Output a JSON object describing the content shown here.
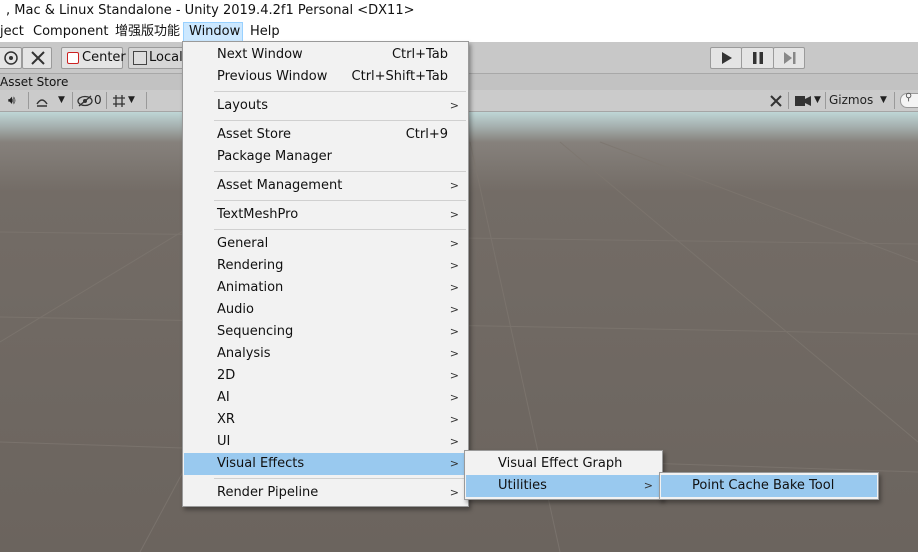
{
  "title_bar": {
    "text": ", Mac & Linux Standalone - Unity 2019.4.2f1 Personal <DX11>"
  },
  "menu_bar": {
    "items": [
      {
        "label": "ject"
      },
      {
        "label": "Component"
      },
      {
        "label": "增强版功能"
      },
      {
        "label": "Window"
      },
      {
        "label": "Help"
      }
    ]
  },
  "toolbar": {
    "pivot_center_label": "Center",
    "pivot_local_label": "Local",
    "play_icon": "play-icon",
    "pause_icon": "pause-icon",
    "step_icon": "step-icon"
  },
  "scene_tab": {
    "label": "Asset Store"
  },
  "scene_toolbar": {
    "hidden_count": "0",
    "gizmos_label": "Gizmos"
  },
  "window_menu": {
    "items": [
      {
        "label": "Next Window",
        "shortcut": "Ctrl+Tab"
      },
      {
        "label": "Previous Window",
        "shortcut": "Ctrl+Shift+Tab"
      },
      {
        "label": "Layouts",
        "submenu": true
      },
      {
        "label": "Asset Store",
        "shortcut": "Ctrl+9"
      },
      {
        "label": "Package Manager"
      },
      {
        "label": "Asset Management",
        "submenu": true
      },
      {
        "label": "TextMeshPro",
        "submenu": true
      },
      {
        "label": "General",
        "submenu": true
      },
      {
        "label": "Rendering",
        "submenu": true
      },
      {
        "label": "Animation",
        "submenu": true
      },
      {
        "label": "Audio",
        "submenu": true
      },
      {
        "label": "Sequencing",
        "submenu": true
      },
      {
        "label": "Analysis",
        "submenu": true
      },
      {
        "label": "2D",
        "submenu": true
      },
      {
        "label": "AI",
        "submenu": true
      },
      {
        "label": "XR",
        "submenu": true
      },
      {
        "label": "UI",
        "submenu": true
      },
      {
        "label": "Visual Effects",
        "submenu": true,
        "highlighted": true
      },
      {
        "label": "Render Pipeline",
        "submenu": true
      }
    ]
  },
  "visual_effects_menu": {
    "items": [
      {
        "label": "Visual Effect Graph"
      },
      {
        "label": "Utilities",
        "submenu": true,
        "highlighted": true
      }
    ]
  },
  "utilities_menu": {
    "items": [
      {
        "label": "Point Cache Bake Tool",
        "highlighted": true
      }
    ]
  },
  "colors": {
    "menu_highlight": "#99c9ef",
    "active_menu_bg": "#cce8ff",
    "toolbar_bg": "#c8c8c8",
    "scene_ground": "#6b645e"
  }
}
